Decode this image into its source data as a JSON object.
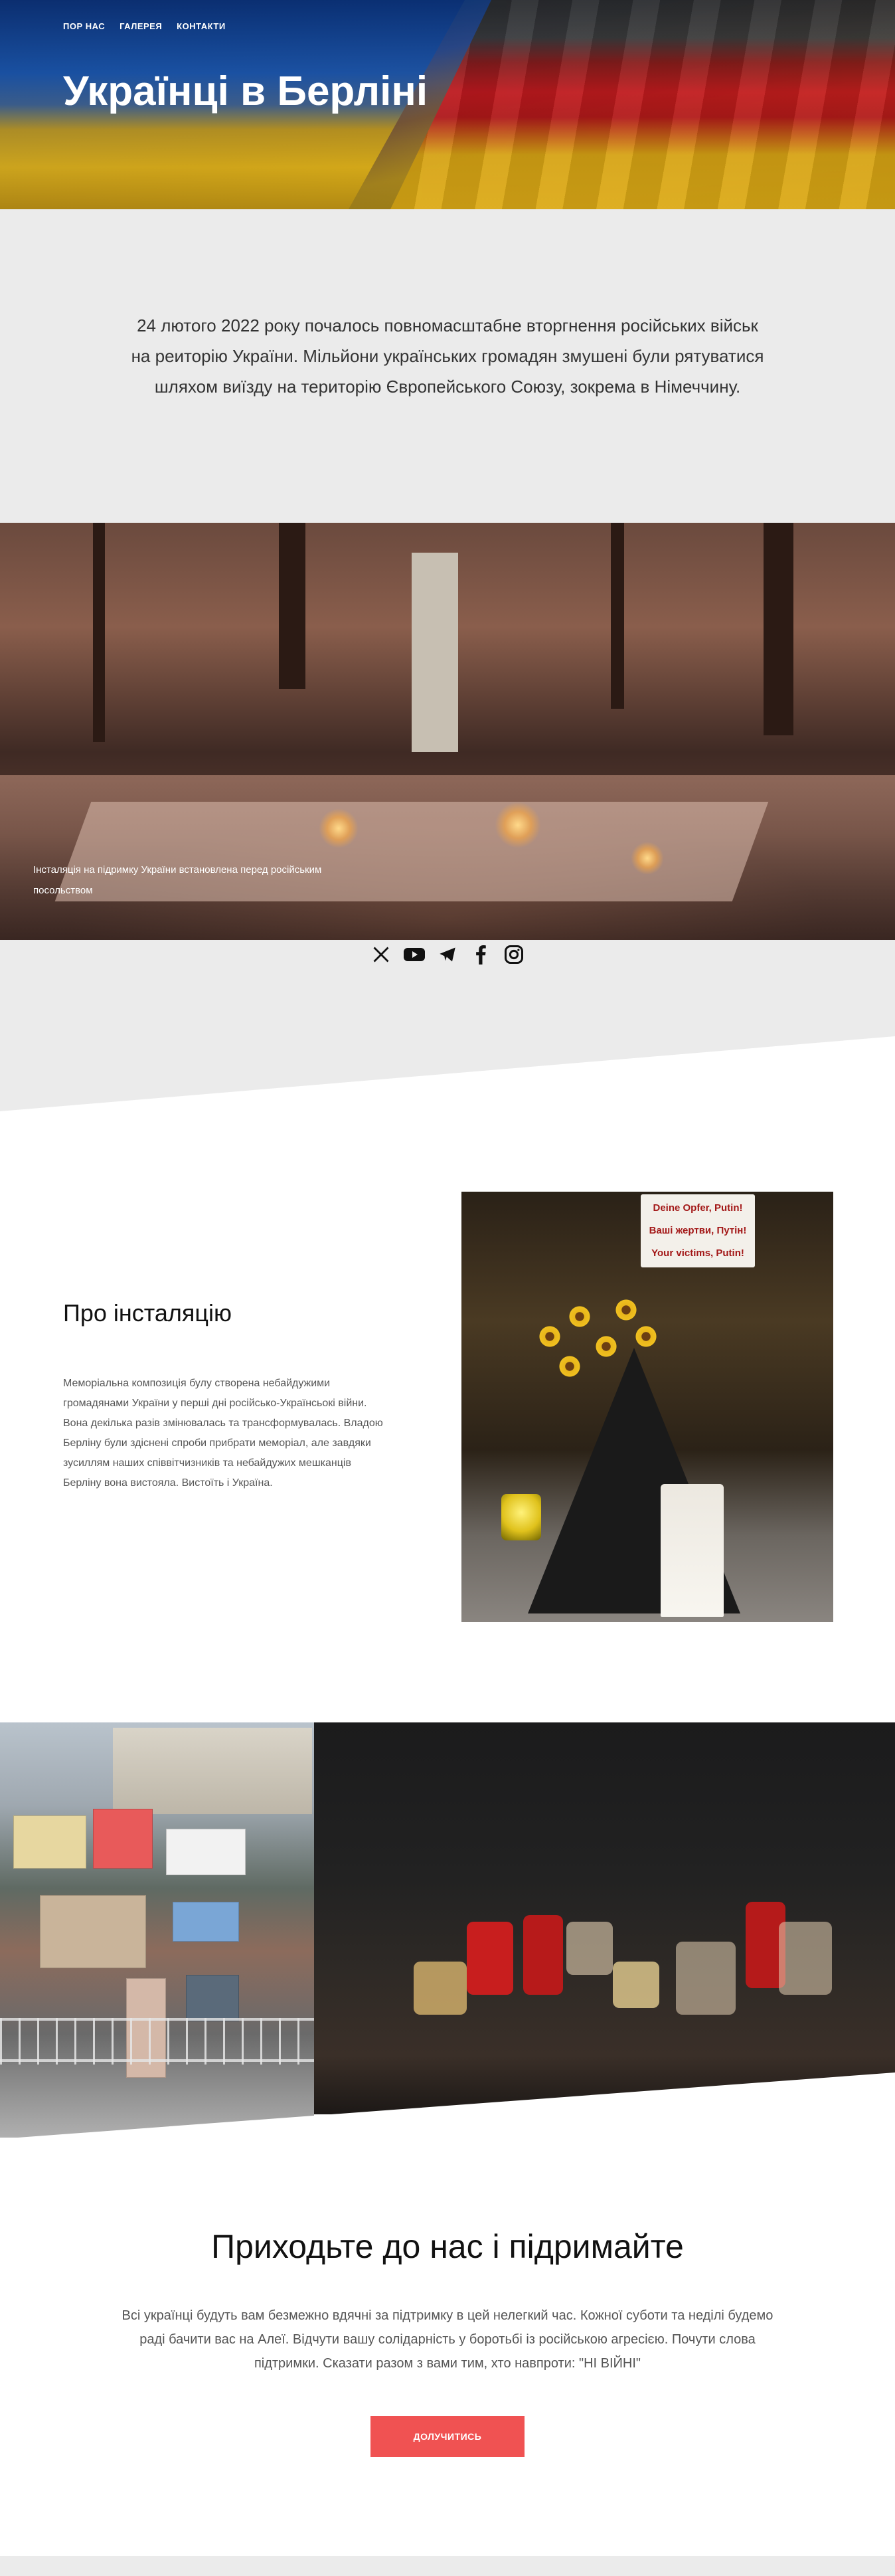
{
  "nav": {
    "items": [
      "ПОР НАС",
      "ГАЛЕРЕЯ",
      "КОНТАКТИ"
    ]
  },
  "hero": {
    "title": "Українці в Берліні"
  },
  "intro": {
    "text": "24 лютого 2022 року почалось повномасштабне вторгнення російських військ на реиторію України. Мільйони українських громадян змушені були рятуватися шляхом виїзду на територію Європейського Союзу, зокрема в Німеччину."
  },
  "photo1": {
    "caption": "Інсталяція на підримку України встановлена перед російським посольством"
  },
  "social": {
    "icons": [
      "x-icon",
      "youtube-icon",
      "telegram-icon",
      "facebook-icon",
      "instagram-icon"
    ]
  },
  "about": {
    "title": "Про інсталяцію",
    "text": "Меморіальна композиція булу створена небайдужими громадянами України у перші дні російсько-Українсьокі війни. Вона декілька разів змінювалась та трансформувалась. Владою Берліну були здіснені спроби прибрати меморіал, але завдяки зусиллям наших співвітчизників та небайдужих мешканців Берліну вона вистояла. Вистоїть і Україна.",
    "sign_lines": [
      "Deine Opfer, Putin!",
      "Ваші жертви, Путін!",
      "Your victims, Putin!"
    ]
  },
  "cta": {
    "title": "Приходьте до нас і підримайте",
    "text": "Всі українці будуть вам безмежно вдячні за підтримку в цей нелегкий час. Кожної суботи та неділі будемо раді бачити вас на Алеї. Відчути вашу солідарність у боротьбі із російською агресією. Почути слова підтримки. Сказати разом з вами тим, хто навпроти: \"НІ ВІЙНІ\"",
    "button_label": "ДОЛУЧИТИСЬ"
  },
  "colors": {
    "accent": "#f05252",
    "band": "#ebebeb"
  }
}
